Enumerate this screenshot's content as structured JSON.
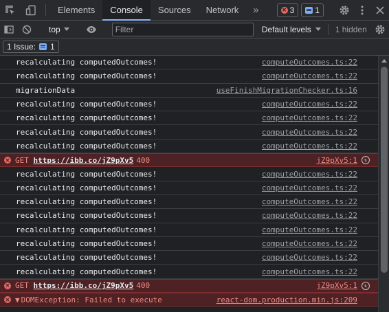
{
  "tabbar": {
    "tabs": [
      "Elements",
      "Console",
      "Sources",
      "Network"
    ],
    "active_tab": "Console",
    "more_glyph": "»",
    "errors_count": "3",
    "messages_count": "1"
  },
  "toolbar": {
    "context": "top",
    "filter_placeholder": "Filter",
    "levels_label": "Default levels",
    "hidden_label": "1 hidden"
  },
  "issues": {
    "label": "1 Issue:",
    "count": "1"
  },
  "log": [
    {
      "type": "log",
      "message": "recalculating computedOutcomes!",
      "source": "computeOutcomes.ts:22"
    },
    {
      "type": "log",
      "message": "recalculating computedOutcomes!",
      "source": "computeOutcomes.ts:22"
    },
    {
      "type": "log",
      "message": "migrationData",
      "source": "useFinishMigrationChecker.ts:16"
    },
    {
      "type": "log",
      "message": "recalculating computedOutcomes!",
      "source": "computeOutcomes.ts:22"
    },
    {
      "type": "log",
      "message": "recalculating computedOutcomes!",
      "source": "computeOutcomes.ts:22"
    },
    {
      "type": "log",
      "message": "recalculating computedOutcomes!",
      "source": "computeOutcomes.ts:22"
    },
    {
      "type": "log",
      "message": "recalculating computedOutcomes!",
      "source": "computeOutcomes.ts:22"
    },
    {
      "type": "error",
      "method": "GET",
      "url": "https://ibb.co/jZ9pXv5",
      "status": "400",
      "source": "jZ9pXv5:1"
    },
    {
      "type": "log",
      "message": "recalculating computedOutcomes!",
      "source": "computeOutcomes.ts:22"
    },
    {
      "type": "log",
      "message": "recalculating computedOutcomes!",
      "source": "computeOutcomes.ts:22"
    },
    {
      "type": "log",
      "message": "recalculating computedOutcomes!",
      "source": "computeOutcomes.ts:22"
    },
    {
      "type": "log",
      "message": "recalculating computedOutcomes!",
      "source": "computeOutcomes.ts:22"
    },
    {
      "type": "log",
      "message": "recalculating computedOutcomes!",
      "source": "computeOutcomes.ts:22"
    },
    {
      "type": "log",
      "message": "recalculating computedOutcomes!",
      "source": "computeOutcomes.ts:22"
    },
    {
      "type": "log",
      "message": "recalculating computedOutcomes!",
      "source": "computeOutcomes.ts:22"
    },
    {
      "type": "log",
      "message": "recalculating computedOutcomes!",
      "source": "computeOutcomes.ts:22"
    },
    {
      "type": "error",
      "method": "GET",
      "url": "https://ibb.co/jZ9pXv5",
      "status": "400",
      "source": "jZ9pXv5:1"
    },
    {
      "type": "exception",
      "message": "DOMException: Failed to execute",
      "source": "react-dom.production.min.js:209"
    }
  ],
  "colors": {
    "background": "#202124",
    "toolbar": "#292a2d",
    "error_row": "#4e2124",
    "error_text": "#f28b82",
    "accent": "#8ab4f8"
  },
  "icons": [
    "inspect-icon",
    "device-toggle-icon",
    "sidebar-icon",
    "clear-console-icon",
    "eye-icon",
    "gear-icon",
    "kebab-menu-icon",
    "close-icon",
    "error-icon",
    "info-icon",
    "network-icon"
  ]
}
